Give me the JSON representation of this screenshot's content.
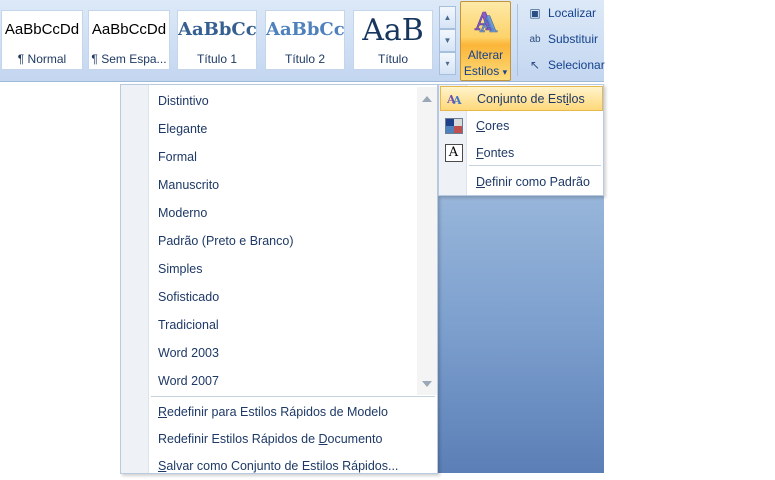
{
  "quick_styles": [
    {
      "sample": "AaBbCcDd",
      "name": "¶ Normal"
    },
    {
      "sample": "AaBbCcDd",
      "name": "¶ Sem Espa..."
    },
    {
      "sample": "AaBbCc",
      "name": "Título 1"
    },
    {
      "sample": "AaBbCc",
      "name": "Título 2"
    },
    {
      "sample": "AaB",
      "name": "Título"
    }
  ],
  "alterar_estilos": {
    "line1": "Alterar",
    "line2": "Estilos",
    "arrow": "▾"
  },
  "editing": [
    {
      "icon": "binoculars-icon",
      "glyph": "🔍",
      "label": "Localizar"
    },
    {
      "icon": "replace-icon",
      "glyph": "ab",
      "label": "Substituir"
    },
    {
      "icon": "cursor-icon",
      "glyph": "↖",
      "label": "Selecionar"
    }
  ],
  "style_sets": [
    "Distintivo",
    "Elegante",
    "Formal",
    "Manuscrito",
    "Moderno",
    "Padrão (Preto e Branco)",
    "Simples",
    "Sofisticado",
    "Tradicional",
    "Word 2003",
    "Word 2007"
  ],
  "style_actions": [
    {
      "pre": "",
      "key": "R",
      "post": "edefinir para Estilos Rápidos de Modelo"
    },
    {
      "pre": "Redefinir Estilos Rápidos de ",
      "key": "D",
      "post": "ocumento"
    },
    {
      "pre": "",
      "key": "S",
      "post": "alvar como Conjunto de Estilos Rápidos..."
    }
  ],
  "submenu": [
    {
      "pre": "Conjunto de Est",
      "key": "i",
      "post": "los",
      "highlighted": true
    },
    {
      "pre": "",
      "key": "C",
      "post": "ores",
      "highlighted": false
    },
    {
      "pre": "",
      "key": "F",
      "post": "ontes",
      "highlighted": false
    },
    {
      "pre": "",
      "key": "D",
      "post": "efinir como Padrão",
      "highlighted": false
    }
  ],
  "colors": {
    "accent": "#15428b",
    "highlight": "#ffd87a",
    "ribbon": "#cfdff4"
  }
}
